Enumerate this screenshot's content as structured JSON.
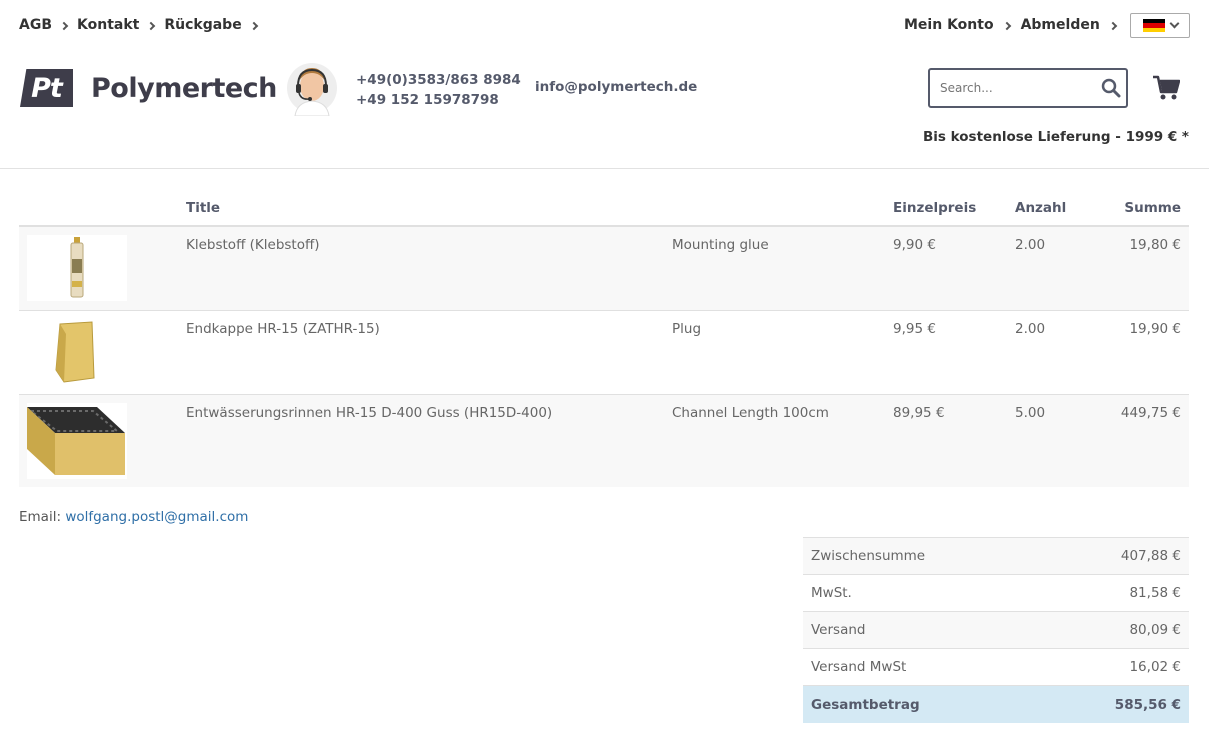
{
  "topnav": [
    {
      "label": "AGB"
    },
    {
      "label": "Kontakt"
    },
    {
      "label": "Rückgabe"
    }
  ],
  "account": {
    "my_account": "Mein Konto",
    "logout": "Abmelden"
  },
  "language": {
    "flag": "de-flag-icon"
  },
  "brand": {
    "mark": "Pt",
    "name": "Polymertech"
  },
  "contact": {
    "phone1": "+49(0)3583/863 8984",
    "phone2": "+49 152 15978798",
    "email": "info@polymertech.de"
  },
  "search": {
    "placeholder": "Search...",
    "value": ""
  },
  "delivery_note": "Bis kostenlose Lieferung - 1999 € *",
  "table": {
    "headers": {
      "title": "Title",
      "price": "Einzelpreis",
      "qty": "Anzahl",
      "sum": "Summe"
    },
    "rows": [
      {
        "title": "Klebstoff (Klebstoff)",
        "desc": "Mounting glue",
        "price": "9,90 €",
        "qty": "2.00",
        "sum": "19,80 €",
        "image": "glue-tube-image"
      },
      {
        "title": "Endkappe HR-15 (ZATHR-15)",
        "desc": "Plug",
        "price": "9,95 €",
        "qty": "2.00",
        "sum": "19,90 €",
        "image": "end-cap-image"
      },
      {
        "title": "Entwässerungsrinnen HR-15 D-400 Guss (HR15D-400)",
        "desc": "Channel Length 100cm",
        "price": "89,95 €",
        "qty": "5.00",
        "sum": "449,75 €",
        "image": "drainage-channel-image"
      }
    ]
  },
  "customer_email": {
    "label": "Email:",
    "value": "wolfgang.postl@gmail.com"
  },
  "totals": [
    {
      "label": "Zwischensumme",
      "value": "407,88 €"
    },
    {
      "label": "MwSt.",
      "value": "81,58 €"
    },
    {
      "label": "Versand",
      "value": "80,09 €"
    },
    {
      "label": "Versand MwSt",
      "value": "16,02 €"
    },
    {
      "label": "Gesamtbetrag",
      "value": "585,56 €"
    }
  ],
  "colors": {
    "brand_dark": "#3e3d4a",
    "link": "#2f6fa7",
    "total_bg": "#d4e9f4"
  }
}
